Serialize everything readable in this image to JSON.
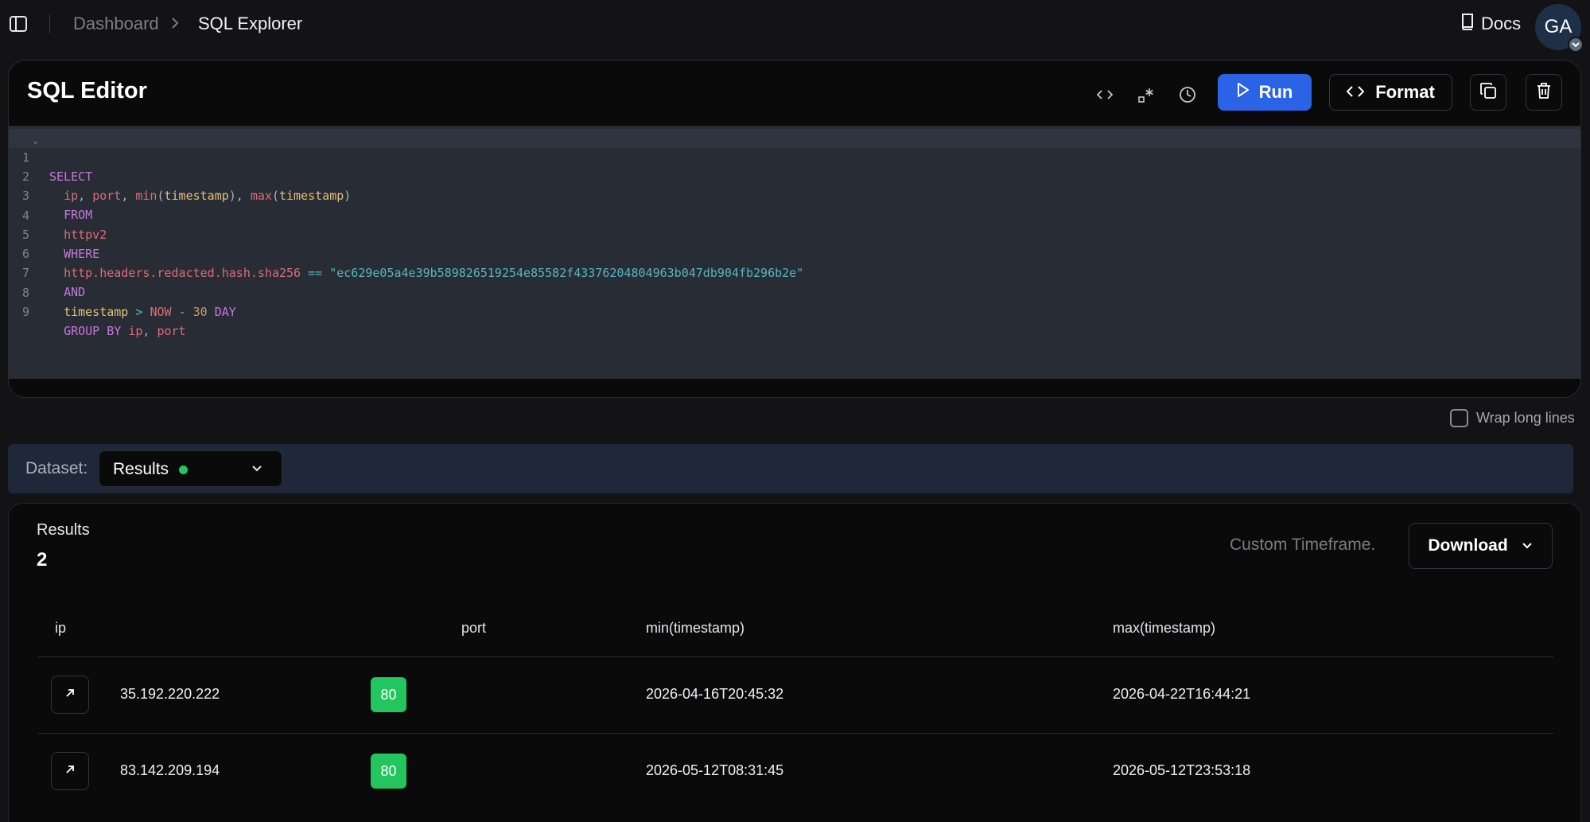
{
  "topbar": {
    "breadcrumb": [
      "Dashboard",
      "SQL Explorer"
    ],
    "docs_label": "Docs",
    "avatar_initials": "GA"
  },
  "editor": {
    "title": "SQL Editor",
    "run_label": "Run",
    "format_label": "Format",
    "line_numbers": [
      "1",
      "2",
      "3",
      "4",
      "5",
      "6",
      "7",
      "8",
      "9"
    ],
    "sql_lines": [
      "SELECT",
      "  ip, port, min(timestamp), max(timestamp)",
      "  FROM",
      "  httpv2",
      "  WHERE",
      "  http.headers.redacted.hash.sha256 == \"ec629e05a4e39b589826519254e85582f43376204804963b047db904fb296b2e\"",
      "  AND",
      "  timestamp > NOW - 30 DAY",
      "  GROUP BY ip, port"
    ],
    "wrap_label": "Wrap long lines",
    "wrap_checked": false
  },
  "dataset": {
    "label": "Dataset:",
    "selected": "Results",
    "status_color": "#22c55e"
  },
  "results": {
    "label": "Results",
    "count": "2",
    "timeframe": "Custom Timeframe.",
    "download_label": "Download",
    "columns": [
      "ip",
      "port",
      "min(timestamp)",
      "max(timestamp)"
    ],
    "rows": [
      {
        "ip": "35.192.220.222",
        "port": "80",
        "min": "2026-04-16T20:45:32",
        "max": "2026-04-22T16:44:21"
      },
      {
        "ip": "83.142.209.194",
        "port": "80",
        "min": "2026-05-12T08:31:45",
        "max": "2026-05-12T23:53:18"
      }
    ]
  },
  "colors": {
    "accent": "#2b63e6",
    "status_green": "#22c55e",
    "editor_bg": "#282c34"
  },
  "icons": [
    "sidebar-toggle-icon",
    "chevron-right-icon",
    "book-icon",
    "chevron-down-icon",
    "code-icon",
    "regex-icon",
    "history-icon",
    "play-icon",
    "copy-icon",
    "trash-icon",
    "arrow-up-right-icon"
  ]
}
